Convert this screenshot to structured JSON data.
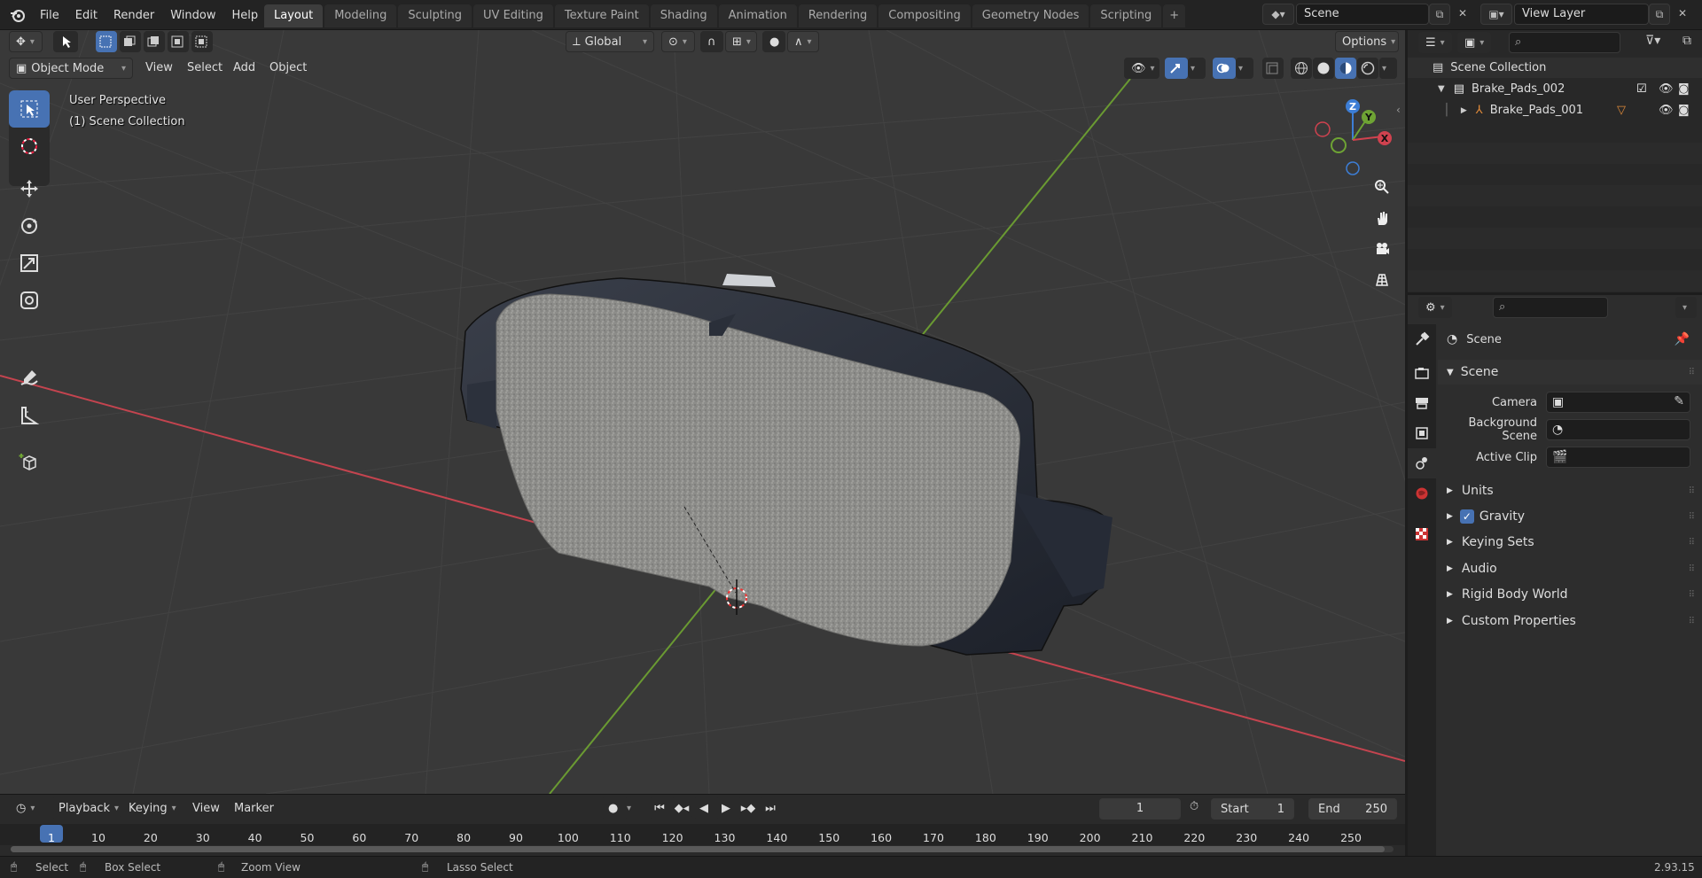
{
  "menu": [
    "File",
    "Edit",
    "Render",
    "Window",
    "Help"
  ],
  "tabs": [
    "Layout",
    "Modeling",
    "Sculpting",
    "UV Editing",
    "Texture Paint",
    "Shading",
    "Animation",
    "Rendering",
    "Compositing",
    "Geometry Nodes",
    "Scripting"
  ],
  "active_tab": "Layout",
  "scene_name": "Scene",
  "view_layer": "View Layer",
  "viewport_header": {
    "orientation": "Global",
    "options": "Options",
    "mode": "Object Mode",
    "menus": [
      "View",
      "Select",
      "Add",
      "Object"
    ]
  },
  "viewport": {
    "perspective": "User Perspective",
    "collection": "(1) Scene Collection",
    "gizmo": {
      "x": "X",
      "y": "Y",
      "z": "Z"
    }
  },
  "outliner": {
    "root": "Scene Collection",
    "items": [
      {
        "name": "Brake_Pads_002",
        "level": 1
      },
      {
        "name": "Brake_Pads_001",
        "level": 2
      }
    ]
  },
  "properties": {
    "context": "Scene",
    "panel": "Scene",
    "fields": [
      {
        "label": "Camera"
      },
      {
        "label": "Background Scene"
      },
      {
        "label": "Active Clip"
      }
    ],
    "subpanels": [
      "Units",
      "Gravity",
      "Keying Sets",
      "Audio",
      "Rigid Body World",
      "Custom Properties"
    ]
  },
  "timeline": {
    "menus": [
      "Playback",
      "Keying",
      "View",
      "Marker"
    ],
    "current_frame": "1",
    "start_label": "Start",
    "start": "1",
    "end_label": "End",
    "end": "250",
    "ticks": [
      "1",
      "10",
      "20",
      "30",
      "40",
      "50",
      "60",
      "70",
      "80",
      "90",
      "100",
      "110",
      "120",
      "130",
      "140",
      "150",
      "160",
      "170",
      "180",
      "190",
      "200",
      "210",
      "220",
      "230",
      "240",
      "250"
    ]
  },
  "status": {
    "select": "Select",
    "box_select": "Box Select",
    "zoom_view": "Zoom View",
    "lasso_select": "Lasso Select",
    "version": "2.93.15"
  },
  "colors": {
    "accent": "#4772b3",
    "x_axis": "#d0424f",
    "y_axis": "#6ea334",
    "z_axis": "#3d7ed6"
  }
}
